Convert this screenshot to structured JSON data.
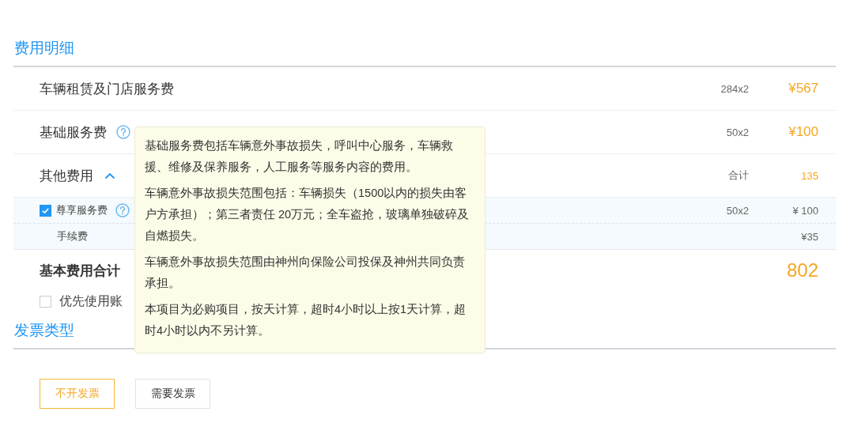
{
  "section_title": "费用明细",
  "fees": [
    {
      "kind": "main",
      "label": "车辆租赁及门店服务费",
      "quantity": "284x2",
      "amount": "¥567"
    },
    {
      "kind": "main",
      "label": "基础服务费",
      "help": true,
      "quantity": "50x2",
      "amount": "¥100"
    },
    {
      "kind": "group",
      "label": "其他费用",
      "expanded": true,
      "quantity": "合计",
      "amount": "135"
    },
    {
      "kind": "sub",
      "label": "尊享服务费",
      "checked": true,
      "help": true,
      "quantity": "50x2",
      "amount": "¥ 100"
    },
    {
      "kind": "sub",
      "label": "手续费",
      "amount": "¥35"
    }
  ],
  "total": {
    "label": "基本费用合计",
    "amount": "802"
  },
  "balance_option": {
    "label": "优先使用账",
    "checked": false
  },
  "tooltip": {
    "paragraphs": [
      "基础服务费包括车辆意外事故损失，呼叫中心服务，车辆救援、维修及保养服务，人工服务等服务内容的费用。",
      "车辆意外事故损失范围包括：车辆损失（1500以内的损失由客户方承担）；第三者责任 20万元；全车盗抢，玻璃单独破碎及自燃损失。",
      "车辆意外事故损失范围由神州向保险公司投保及神州共同负责承担。",
      "本项目为必购项目，按天计算，超时4小时以上按1天计算，超时4小时以内不另计算。"
    ]
  },
  "invoice": {
    "title": "发票类型",
    "options": [
      {
        "label": "不开发票",
        "selected": true
      },
      {
        "label": "需要发票",
        "selected": false
      }
    ]
  }
}
